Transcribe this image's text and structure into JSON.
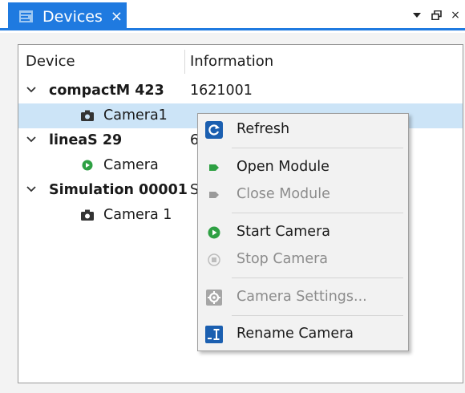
{
  "tab": {
    "title": "Devices",
    "close_glyph": "×"
  },
  "pane_buttons": {
    "dropdown_glyph": "▾",
    "float_glyph": "⧉",
    "close_glyph": "×"
  },
  "columns": {
    "device": "Device",
    "information": "Information"
  },
  "devices": [
    {
      "name": "compactM 423",
      "info": "1621001",
      "camera": "Camera1",
      "camera_icon": "camera-icon"
    },
    {
      "name": "lineaS 29",
      "info": "6",
      "camera": "Camera",
      "camera_icon": "play-icon"
    },
    {
      "name": "Simulation 00001",
      "info": "S",
      "camera": "Camera 1",
      "camera_icon": "camera-icon"
    }
  ],
  "context_menu": {
    "refresh": "Refresh",
    "open_module": "Open Module",
    "close_module": "Close Module",
    "start_camera": "Start Camera",
    "stop_camera": "Stop Camera",
    "camera_settings": "Camera Settings...",
    "rename_camera": "Rename Camera"
  },
  "colors": {
    "accent": "#1f7ae0",
    "selection": "#cce4f7",
    "start_green": "#2ea043",
    "refresh_blue": "#1b5fb0"
  }
}
